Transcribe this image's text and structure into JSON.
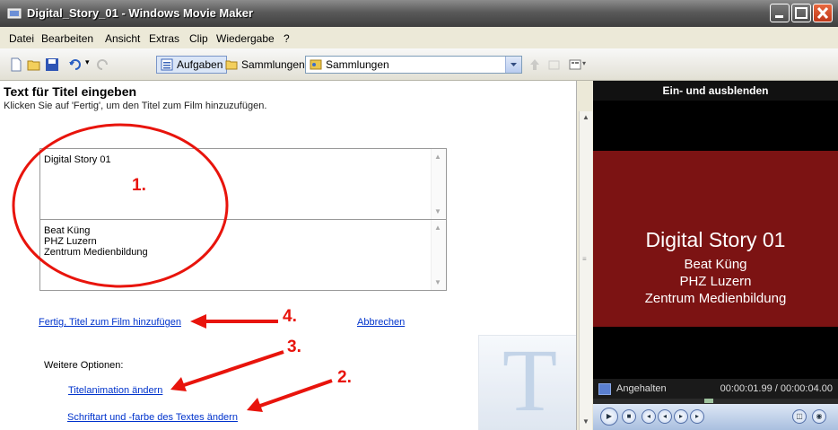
{
  "window": {
    "title": "Digital_Story_01 - Windows Movie Maker"
  },
  "menu": [
    "Datei",
    "Bearbeiten",
    "Ansicht",
    "Extras",
    "Clip",
    "Wiedergabe",
    "?"
  ],
  "toolbar": {
    "tasks_label": "Aufgaben",
    "collections_label": "Sammlungen",
    "collections_dropdown_value": "Sammlungen"
  },
  "title_panel": {
    "heading": "Text für Titel eingeben",
    "instruction": "Klicken Sie auf 'Fertig', um den Titel zum Film hinzuzufügen.",
    "title_text": "Digital Story 01",
    "subtitle_text": "Beat Küng\nPHZ Luzern\nZentrum Medienbildung",
    "done_link": "Fertig, Titel zum Film hinzufügen",
    "cancel_link": "Abbrechen",
    "more_options_label": "Weitere Optionen:",
    "option_animation": "Titelanimation ändern",
    "option_font": "Schriftart und -farbe des Textes ändern"
  },
  "annotations": [
    "1.",
    "2.",
    "3.",
    "4."
  ],
  "preview": {
    "header": "Ein- und ausblenden",
    "slide_title": "Digital Story 01",
    "slide_line1": "Beat Küng",
    "slide_line2": "PHZ Luzern",
    "slide_line3": "Zentrum Medienbildung",
    "status": "Angehalten",
    "time": "00:00:01.99 / 00:00:04.00",
    "slide_background": "#7c1313"
  },
  "colors": {
    "annotation_red": "#e8140c",
    "link_blue": "#0033cc"
  }
}
